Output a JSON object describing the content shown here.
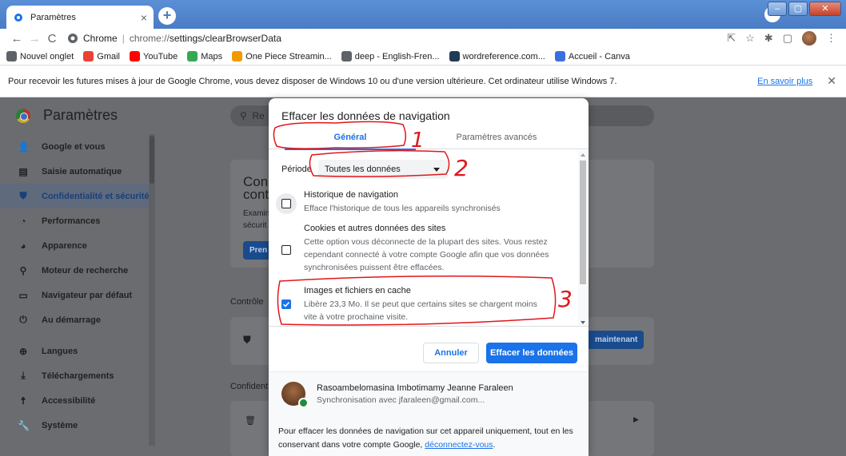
{
  "browser": {
    "tab_title": "Paramètres",
    "tab_close": "×",
    "new_tab": "+",
    "omnibox_site": "Chrome",
    "omnibox_separator": "|",
    "url_prefix": "chrome://",
    "url_path": "settings/clearBrowserData",
    "window_controls": [
      "–",
      "▢",
      "✕"
    ]
  },
  "bookmarks": [
    {
      "label": "Nouvel onglet",
      "icon": "globe-icon",
      "color": "#5f6368"
    },
    {
      "label": "Gmail",
      "icon": "gmail-icon",
      "color": "#ea4335"
    },
    {
      "label": "YouTube",
      "icon": "youtube-icon",
      "color": "#ff0000"
    },
    {
      "label": "Maps",
      "icon": "maps-icon",
      "color": "#34a853"
    },
    {
      "label": "One Piece Streamin...",
      "icon": "onepiece-icon",
      "color": "#f29900"
    },
    {
      "label": "deep - English-Fren...",
      "icon": "globe-icon",
      "color": "#5f6368"
    },
    {
      "label": "wordreference.com...",
      "icon": "wordreference-icon",
      "color": "#1f3b57"
    },
    {
      "label": "Accueil - Canva",
      "icon": "canva-icon",
      "color": "#3b6fe0"
    }
  ],
  "infobar": {
    "message": "Pour recevoir les futures mises à jour de Google Chrome, vous devez disposer de Windows 10 ou d'une version ultérieure. Cet ordinateur utilise Windows 7.",
    "link": "En savoir plus",
    "close": "✕"
  },
  "settings": {
    "title": "Paramètres",
    "search_placeholder": "Re",
    "sidebar": [
      {
        "label": "Google et vous",
        "icon": "person-icon",
        "glyph": "👤"
      },
      {
        "label": "Saisie automatique",
        "icon": "autofill-icon",
        "glyph": "▤"
      },
      {
        "label": "Confidentialité et sécurité",
        "icon": "shield-icon",
        "glyph": "⛊",
        "active": true
      },
      {
        "label": "Performances",
        "icon": "speedometer-icon",
        "glyph": "◔"
      },
      {
        "label": "Apparence",
        "icon": "palette-icon",
        "glyph": "◕"
      },
      {
        "label": "Moteur de recherche",
        "icon": "search-icon",
        "glyph": "⚲"
      },
      {
        "label": "Navigateur par défaut",
        "icon": "browser-icon",
        "glyph": "▭"
      },
      {
        "label": "Au démarrage",
        "icon": "power-icon",
        "glyph": "⏻"
      },
      {
        "label": "Langues",
        "icon": "language-icon",
        "glyph": "⊕"
      },
      {
        "label": "Téléchargements",
        "icon": "download-icon",
        "glyph": "⤓"
      },
      {
        "label": "Accessibilité",
        "icon": "accessibility-icon",
        "glyph": "☨"
      },
      {
        "label": "Système",
        "icon": "wrench-icon",
        "glyph": "🔧"
      }
    ],
    "ghost": {
      "card_title_1": "Con",
      "card_title_2": "cont",
      "card_text_1": "Examin",
      "card_text_2": "sécurit",
      "card_btn": "Pren",
      "section_controle": "Contrôle",
      "section_confident": "Confident",
      "maintenant_btn": "maintenant"
    }
  },
  "dialog": {
    "title": "Effacer les données de navigation",
    "tabs": [
      {
        "label": "Général",
        "active": true
      },
      {
        "label": "Paramètres avancés",
        "active": false
      }
    ],
    "period_label": "Période",
    "period_value": "Toutes les données",
    "items": [
      {
        "title": "Historique de navigation",
        "desc": "Efface l'historique de tous les appareils synchronisés",
        "checked": false
      },
      {
        "title": "Cookies et autres données des sites",
        "desc": "Cette option vous déconnecte de la plupart des sites. Vous restez cependant connecté à votre compte Google afin que vos données synchronisées puissent être effacées.",
        "checked": false
      },
      {
        "title": "Images et fichiers en cache",
        "desc": "Libère 23,3 Mo. Il se peut que certains sites se chargent moins vite à votre prochaine visite.",
        "checked": true
      }
    ],
    "cancel_label": "Annuler",
    "clear_label": "Effacer les données",
    "account_name": "Rasoambelomasina Imbotimamy Jeanne Faraleen",
    "account_sync": "Synchronisation avec jfaraleen@gmail.com...",
    "footer_text": "Pour effacer les données de navigation sur cet appareil uniquement, tout en les conservant dans votre compte Google, ",
    "footer_link": "déconnectez-vous",
    "footer_end": "."
  },
  "annotations": {
    "color": "#e0161b",
    "labels": [
      "1",
      "2",
      "3"
    ]
  }
}
